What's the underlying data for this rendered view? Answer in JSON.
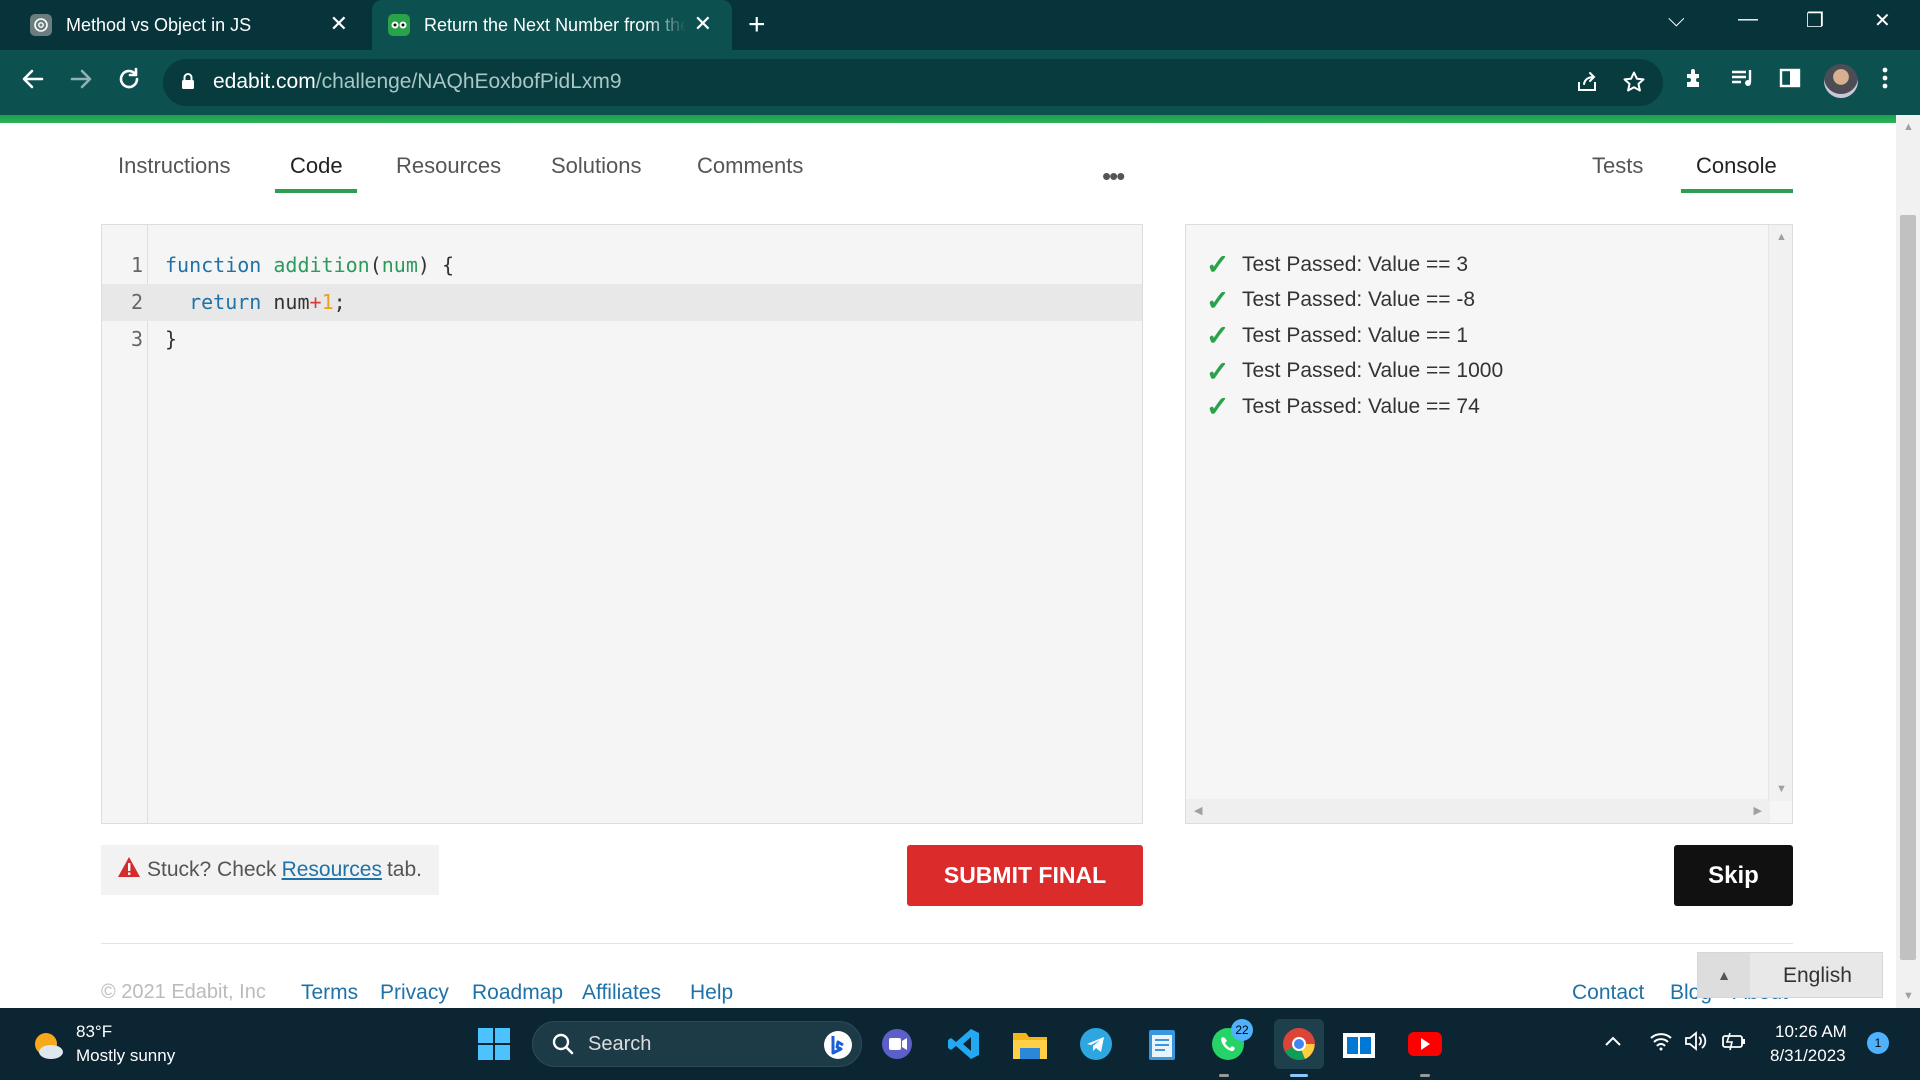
{
  "browser": {
    "tabs": [
      {
        "title": "Method vs Object in JS",
        "close": "✕"
      },
      {
        "title": "Return the Next Number from the Integer Passed",
        "close": "✕"
      }
    ],
    "new_tab": "+",
    "window_controls": {
      "dropdown": "⌵",
      "minimize": "—",
      "restore": "❐",
      "close": "✕"
    },
    "url_domain": "edabit.com",
    "url_path": "/challenge/NAQhEoxbofPidLxm9"
  },
  "page": {
    "tabs": [
      "Instructions",
      "Code",
      "Resources",
      "Solutions",
      "Comments"
    ],
    "active_tab": "Code",
    "more": "•••",
    "right_tabs": [
      "Tests",
      "Console"
    ],
    "active_right_tab": "Console"
  },
  "editor": {
    "line_numbers": [
      "1",
      "2",
      "3"
    ],
    "lines": [
      [
        {
          "t": "function",
          "c": "kw"
        },
        {
          "t": " "
        },
        {
          "t": "addition",
          "c": "fn"
        },
        {
          "t": "("
        },
        {
          "t": "num",
          "c": "fn"
        },
        {
          "t": ") {"
        }
      ],
      [
        {
          "t": "  "
        },
        {
          "t": "return",
          "c": "kw"
        },
        {
          "t": " num"
        },
        {
          "t": "+",
          "c": "op"
        },
        {
          "t": "1",
          "c": "num"
        },
        {
          "t": ";"
        }
      ],
      [
        {
          "t": "}"
        }
      ]
    ]
  },
  "console": {
    "items": [
      "Test Passed: Value == 3",
      "Test Passed: Value == -8",
      "Test Passed: Value == 1",
      "Test Passed: Value == 1000",
      "Test Passed: Value == 74"
    ],
    "check_icon": "✓"
  },
  "actions": {
    "stuck_prefix": "Stuck? Check",
    "stuck_link": "Resources",
    "stuck_suffix": "tab.",
    "submit": "SUBMIT FINAL",
    "skip": "Skip"
  },
  "footer": {
    "copyright": "© 2021 Edabit, Inc",
    "links": [
      "Terms",
      "Privacy",
      "Roadmap",
      "Affiliates",
      "Help"
    ],
    "right_links": [
      "Contact",
      "Blog",
      "About"
    ],
    "language": "English"
  },
  "taskbar": {
    "weather_temp": "83°F",
    "weather_desc": "Mostly sunny",
    "search": "Search",
    "whatsapp_badge": "22",
    "time": "10:26 AM",
    "date": "8/31/2023",
    "notification_count": "1"
  },
  "colors": {
    "accent_green": "#2f9e4e",
    "submit_red": "#dc2b2b",
    "link_blue": "#1f72a8",
    "chrome_teal": "#0c5050"
  }
}
